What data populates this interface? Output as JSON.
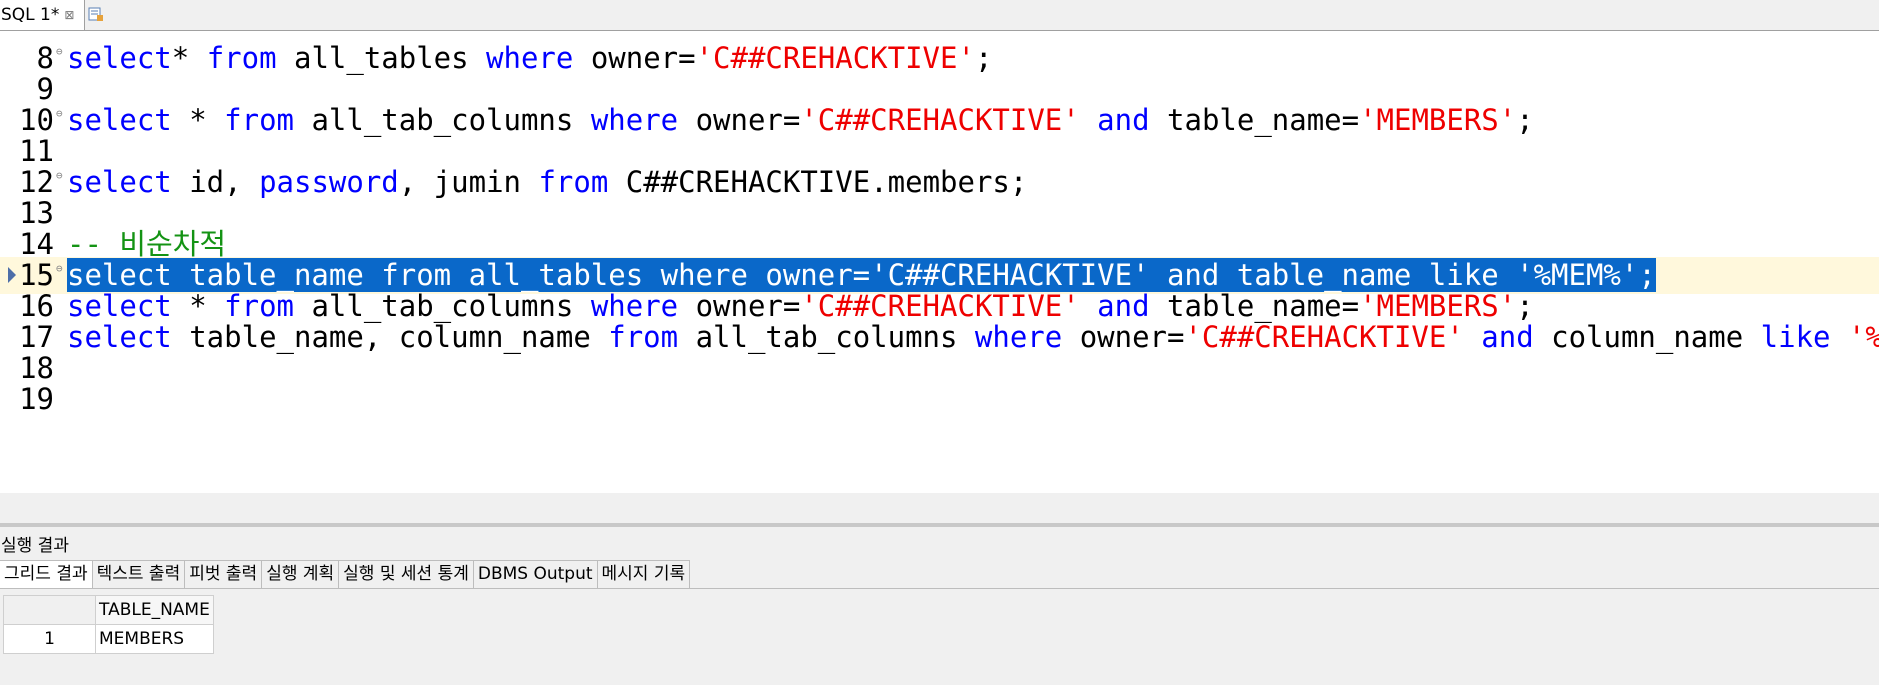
{
  "tab": {
    "label": "SQL 1*",
    "close": "⊠"
  },
  "lines": [
    {
      "n": "8",
      "fold": true,
      "tokens": [
        [
          "kw",
          "select"
        ],
        [
          "",
          "* "
        ],
        [
          "kw",
          "from"
        ],
        [
          "",
          " all_tables "
        ],
        [
          "kw",
          "where"
        ],
        [
          "",
          " owner="
        ],
        [
          "str",
          "'C##CREHACKTIVE'"
        ],
        [
          "",
          ";"
        ]
      ]
    },
    {
      "n": "9",
      "tokens": []
    },
    {
      "n": "10",
      "fold": true,
      "tokens": [
        [
          "kw",
          "select"
        ],
        [
          "",
          " * "
        ],
        [
          "kw",
          "from"
        ],
        [
          "",
          " all_tab_columns "
        ],
        [
          "kw",
          "where"
        ],
        [
          "",
          " owner="
        ],
        [
          "str",
          "'C##CREHACKTIVE'"
        ],
        [
          "",
          " "
        ],
        [
          "kw",
          "and"
        ],
        [
          "",
          " table_name="
        ],
        [
          "str",
          "'MEMBERS'"
        ],
        [
          "",
          ";"
        ]
      ]
    },
    {
      "n": "11",
      "tokens": []
    },
    {
      "n": "12",
      "fold": true,
      "tokens": [
        [
          "kw",
          "select"
        ],
        [
          "",
          " id, "
        ],
        [
          "kw",
          "password"
        ],
        [
          "",
          ", jumin "
        ],
        [
          "kw",
          "from"
        ],
        [
          "",
          " C##CREHACKTIVE.members;"
        ]
      ]
    },
    {
      "n": "13",
      "tokens": []
    },
    {
      "n": "14",
      "tokens": [
        [
          "cmt",
          "-- 비순차적"
        ]
      ]
    },
    {
      "n": "15",
      "fold": true,
      "selected": true,
      "tokens": [
        [
          "sel",
          "select table_name from all_tables where owner='C##CREHACKTIVE' and table_name like '%MEM%';"
        ]
      ]
    },
    {
      "n": "16",
      "tokens": [
        [
          "kw",
          "select"
        ],
        [
          "",
          " * "
        ],
        [
          "kw",
          "from"
        ],
        [
          "",
          " all_tab_columns "
        ],
        [
          "kw",
          "where"
        ],
        [
          "",
          " owner="
        ],
        [
          "str",
          "'C##CREHACKTIVE'"
        ],
        [
          "",
          " "
        ],
        [
          "kw",
          "and"
        ],
        [
          "",
          " table_name="
        ],
        [
          "str",
          "'MEMBERS'"
        ],
        [
          "",
          ";"
        ]
      ]
    },
    {
      "n": "17",
      "tokens": [
        [
          "kw",
          "select"
        ],
        [
          "",
          " table_name, column_name "
        ],
        [
          "kw",
          "from"
        ],
        [
          "",
          " all_tab_columns "
        ],
        [
          "kw",
          "where"
        ],
        [
          "",
          " owner="
        ],
        [
          "str",
          "'C##CREHACKTIVE'"
        ],
        [
          "",
          " "
        ],
        [
          "kw",
          "and"
        ],
        [
          "",
          " column_name "
        ],
        [
          "kw",
          "like"
        ],
        [
          "",
          " "
        ],
        [
          "str",
          "'%JUMIN%'"
        ],
        [
          "",
          ";"
        ]
      ]
    },
    {
      "n": "18",
      "tokens": []
    },
    {
      "n": "19",
      "tokens": []
    }
  ],
  "results": {
    "title": "실행 결과",
    "tabs": [
      "그리드 결과",
      "텍스트 출력",
      "피벗 출력",
      "실행 계획",
      "실행 및 세션 통계",
      "DBMS Output",
      "메시지 기록"
    ],
    "columns": [
      "TABLE_NAME"
    ],
    "rows": [
      {
        "num": "1",
        "values": [
          "MEMBERS"
        ]
      }
    ]
  }
}
